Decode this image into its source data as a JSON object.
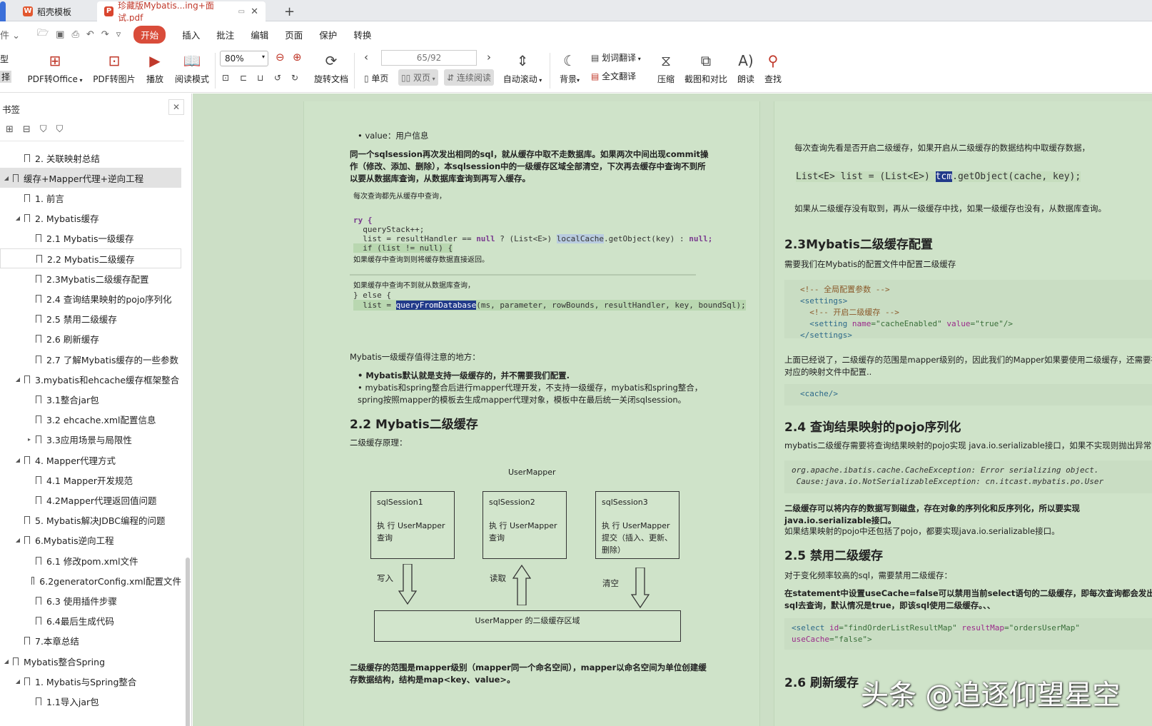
{
  "tabs": [
    {
      "label": "稻壳模板",
      "icon": "W"
    },
    {
      "label": "珍藏版Mybatis...ing+面试.pdf",
      "icon": "P"
    }
  ],
  "new_tab": "+",
  "menu": {
    "file_fragment": "件",
    "items": [
      "开始",
      "插入",
      "批注",
      "编辑",
      "页面",
      "保护",
      "转换"
    ]
  },
  "toolbar": {
    "left_frag1": "型",
    "left_frag2": "择",
    "pdf_to_office": "PDF转Office",
    "pdf_to_image": "PDF转图片",
    "play": "播放",
    "read_mode": "阅读模式",
    "zoom": "80%",
    "rotate_doc": "旋转文档",
    "page_input": "65/92",
    "single_page": "单页",
    "double_page": "双页",
    "continuous": "连续阅读",
    "auto_scroll": "自动滚动",
    "background": "背景",
    "word_translate": "划词翻译",
    "full_translate": "全文翻译",
    "compress": "压缩",
    "screenshot_compare": "截图和对比",
    "read_aloud": "朗读",
    "find": "查找"
  },
  "sidebar": {
    "title": "书签",
    "items": [
      {
        "label": "2. 关联映射总结",
        "level": 1,
        "tri": ""
      },
      {
        "label": "缓存+Mapper代理+逆向工程",
        "level": 0,
        "tri": "◢",
        "selected": true
      },
      {
        "label": "1. 前言",
        "level": 1,
        "tri": ""
      },
      {
        "label": "2. Mybatis缓存",
        "level": 1,
        "tri": "◢"
      },
      {
        "label": "2.1 Mybatis一级缓存",
        "level": 2,
        "tri": ""
      },
      {
        "label": "2.2 Mybatis二级缓存",
        "level": 2,
        "tri": "",
        "hover": true
      },
      {
        "label": "2.3Mybatis二级缓存配置",
        "level": 2,
        "tri": ""
      },
      {
        "label": "2.4 查询结果映射的pojo序列化",
        "level": 2,
        "tri": ""
      },
      {
        "label": "2.5 禁用二级缓存",
        "level": 2,
        "tri": ""
      },
      {
        "label": "2.6 刷新缓存",
        "level": 2,
        "tri": ""
      },
      {
        "label": "2.7 了解Mybatis缓存的一些参数",
        "level": 2,
        "tri": ""
      },
      {
        "label": "3.mybatis和ehcache缓存框架整合",
        "level": 1,
        "tri": "◢"
      },
      {
        "label": "3.1整合jar包",
        "level": 2,
        "tri": ""
      },
      {
        "label": "3.2 ehcache.xml配置信息",
        "level": 2,
        "tri": ""
      },
      {
        "label": "3.3应用场景与局限性",
        "level": 2,
        "tri": "▸"
      },
      {
        "label": "4. Mapper代理方式",
        "level": 1,
        "tri": "◢"
      },
      {
        "label": "4.1 Mapper开发规范",
        "level": 2,
        "tri": ""
      },
      {
        "label": "4.2Mapper代理返回值问题",
        "level": 2,
        "tri": ""
      },
      {
        "label": "5. Mybatis解决JDBC编程的问题",
        "level": 1,
        "tri": ""
      },
      {
        "label": "6.Mybatis逆向工程",
        "level": 1,
        "tri": "◢"
      },
      {
        "label": "6.1 修改pom.xml文件",
        "level": 2,
        "tri": ""
      },
      {
        "label": "6.2generatorConfig.xml配置文件",
        "level": 2,
        "tri": ""
      },
      {
        "label": "6.3 使用插件步骤",
        "level": 2,
        "tri": ""
      },
      {
        "label": "6.4最后生成代码",
        "level": 2,
        "tri": ""
      },
      {
        "label": "7.本章总结",
        "level": 1,
        "tri": ""
      },
      {
        "label": "Mybatis整合Spring",
        "level": 0,
        "tri": "◢"
      },
      {
        "label": "1. Mybatis与Spring整合",
        "level": 1,
        "tri": "◢"
      },
      {
        "label": "1.1导入jar包",
        "level": 2,
        "tri": ""
      }
    ]
  },
  "page1": {
    "bullet_value": "value：用户信息",
    "para1": "同一个sqlsession再次发出相同的sql，就从缓存中取不走数据库。如果两次中间出现commit操作（修改、添加、删除），本sqlsession中的一级缓存区域全部清空，下次再去缓存中查询不到所以要从数据库查询，从数据库查询到再写入缓存。",
    "shot_caption1": "每次查询都先从缓存中查询，",
    "shot_code1": "ry {",
    "shot_code2": "  queryStack++;",
    "shot_code3a": "  list = resultHandler == ",
    "shot_code3b": "null",
    "shot_code3c": " ? (List<E>) ",
    "shot_code3d": "localCache",
    "shot_code3e": ".getObject(key) : ",
    "shot_code3f": "null;",
    "shot_code4": "  if (list != null) {",
    "shot_caption2": "如果缓存中查询到则将缓存数据直接返回。",
    "shot_caption3": "如果缓存中查询不到就从数据库查询，",
    "shot_code5": "} else {",
    "shot_code6a": "  list = ",
    "shot_code6b": "queryFromDatabase",
    "shot_code6c": "(ms, parameter, rowBounds, resultHandler, key, boundSql);",
    "notes_title": "Mybatis一级缓存值得注意的地方：",
    "note1": "Mybatis默认就是支持一级缓存的，并不需要我们配置.",
    "note2": "mybatis和spring整合后进行mapper代理开发，不支持一级缓存，mybatis和spring整合，spring按照mapper的模板去生成mapper代理对象，模板中在最后统一关闭sqlsession。",
    "h_22": "2.2 Mybatis二级缓存",
    "principle": "二级缓存原理：",
    "diagram": {
      "top": "UserMapper",
      "s1_title": "sqlSession1",
      "s1_body": "执 行    UserMapper 查询",
      "s2_title": "sqlSession2",
      "s2_body": "执 行    UserMapper 查询",
      "s3_title": "sqlSession3",
      "s3_body": "执 行    UserMapper 提交（插入、更新、删除）",
      "a1": "写入",
      "a2": "读取",
      "a3": "清空",
      "bottom": "UserMapper 的二级缓存区域"
    },
    "para_end": "二级缓存的范围是mapper级别（mapper同一个命名空间），mapper以命名空间为单位创建缓存数据结构，结构是map<key、value>。"
  },
  "page2": {
    "shot_caption1": "每次查询先看是否开启二级缓存，如果开启从二级缓存的数据结构中取缓存数据，",
    "shot_code_a": "List<E> list = (List<E>) ",
    "shot_code_b": "tcm",
    "shot_code_c": ".getObject(cache, key);",
    "shot_caption2": "如果从二级缓存没有取到，再从一级缓存中找，如果一级缓存也没有，从数据库查询。",
    "h_23": "2.3Mybatis二级缓存配置",
    "p_23": "需要我们在Mybatis的配置文件中配置二级缓存",
    "cfg1": "<!-- 全局配置参数 -->",
    "cfg2": "<settings>",
    "cfg3": "  <!-- 开启二级缓存 -->",
    "cfg4a": "  <setting ",
    "cfg4b": "name",
    "cfg4c": "=\"cacheEnabled\" ",
    "cfg4d": "value",
    "cfg4e": "=\"true\"/>",
    "cfg5": "</settings>",
    "p_23b": "上面已经说了，二级缓存的范围是mapper级别的，因此我们的Mapper如果要使用二级缓存，还需要在对应的映射文件中配置..",
    "cache_tag": "<cache/>",
    "h_24": "2.4 查询结果映射的pojo序列化",
    "p_24": "mybatis二级缓存需要将查询结果映射的pojo实现 java.io.serializable接口，如果不实现则抛出异常：",
    "exc1": "org.apache.ibatis.cache.CacheException: Error serializing object.",
    "exc2": " Cause:java.io.NotSerializableException: cn.itcast.mybatis.po.User",
    "p_24b": "二级缓存可以将内存的数据写到磁盘，存在对象的序列化和反序列化，所以要实现java.io.serializable接口。",
    "p_24c": "如果结果映射的pojo中还包括了pojo，都要实现java.io.serializable接口。",
    "h_25": "2.5 禁用二级缓存",
    "p_25": "对于变化频率较高的sql，需要禁用二级缓存：",
    "p_25b": "在statement中设置useCache=false可以禁用当前select语句的二级缓存，即每次查询都会发出sql去查询，默认情况是true，即该sql使用二级缓存。、、",
    "sel1a": "<select ",
    "sel1b": "id",
    "sel1c": "=\"findOrderListResultMap\" ",
    "sel1d": "resultMap",
    "sel1e": "=\"ordersUserMap\"",
    "sel2a": "useCache",
    "sel2b": "=\"false\">",
    "h_26": "2.6 刷新缓存"
  },
  "watermark": "头条 @追逐仰望星空",
  "colors": {
    "accent": "#d94c3a",
    "page_bg": "#ccdfc6"
  }
}
